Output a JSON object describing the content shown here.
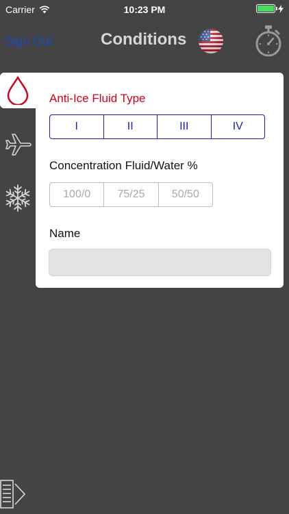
{
  "status_bar": {
    "carrier": "Carrier",
    "time": "10:23 PM"
  },
  "nav": {
    "sign_out": "Sign Out",
    "title": "Conditions"
  },
  "sidebar": {
    "tabs": [
      {
        "icon": "fluid-drop-icon",
        "selected": true
      },
      {
        "icon": "airplane-icon",
        "selected": false
      },
      {
        "icon": "snowflake-icon",
        "selected": false
      }
    ],
    "menu_icon": "menu-arrow-icon"
  },
  "panel": {
    "fluid_type": {
      "label": "Anti-Ice Fluid Type",
      "options": [
        "I",
        "II",
        "III",
        "IV"
      ]
    },
    "concentration": {
      "label": "Concentration Fluid/Water %",
      "options": [
        "100/0",
        "75/25",
        "50/50"
      ]
    },
    "name": {
      "label": "Name",
      "value": "",
      "placeholder": ""
    }
  },
  "colors": {
    "background": "#444444",
    "accent_red": "#d0021b",
    "segment_blue": "#1c1bb0",
    "link_blue": "#1b4bb5",
    "battery_green": "#4cd964"
  }
}
